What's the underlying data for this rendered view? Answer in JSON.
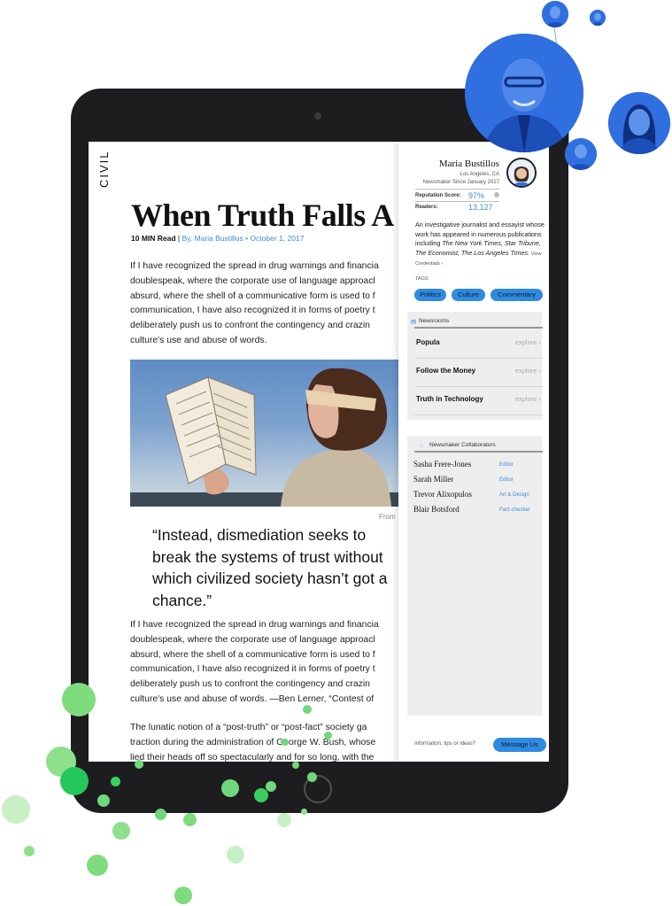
{
  "article": {
    "publication_logo": "CIVIL",
    "headline": "When Truth Falls A",
    "byline_read_time": "10 MIN Read",
    "byline_separator": " | ",
    "byline_author": "By, Maria Bustillos",
    "byline_date": " • October 1, 2017",
    "paragraph_1": "If I have recognized the spread in drug warnings and financia\ndoublespeak, where the corporate use of language approacl\nabsurd, where the shell of a communicative form is used to f\ncommunication, I have also recognized it in forms of poetry t\ndeliberately push us to confront the contingency and crazin\nculture's use and abuse of words.",
    "image_caption": "From",
    "pull_quote": "“Instead, dismediation seeks to break the systems of trust without which civilized society hasn’t got a chance.”",
    "paragraph_2": "If I have recognized the spread in drug warnings and financia\ndoublespeak, where the corporate use of language approacl\nabsurd, where the shell of a communicative form is used to f\ncommunication, I have also recognized it in forms of poetry t\ndeliberately push us to confront the contingency and crazin\nculture's use and abuse of words. —Ben Lerner, “Contest of",
    "paragraph_3": "The lunatic notion of a “post-truth” or “post-fact” society ga\ntraction during the administration of George W. Bush, whose\nlied their heads off so spectacularly and for so long, with the"
  },
  "author": {
    "name": "Maria Bustillos",
    "location": "Los Angeles, CA",
    "since": "Newsmaker Since January 2017",
    "reputation_label": "Reputation Score:",
    "reputation_value": "97%",
    "readers_label": "Readers:",
    "readers_value": "13,127",
    "bio_text": "An investigative journalist and essayist whose work has appeared in numerous publications including ",
    "bio_pubs": "The New York Times, Star Tribune, The Economist, The Los Angeles Times.",
    "bio_credentials": " View Credentials ›"
  },
  "tags": {
    "label": "TAGS",
    "items": [
      "Politics",
      "Culture",
      "Commentary"
    ]
  },
  "newsrooms": {
    "title": "Newsrooms",
    "items": [
      {
        "name": "Popula",
        "link": "explore ›"
      },
      {
        "name": "Follow the Money",
        "link": "explore ›"
      },
      {
        "name": "Truth in Technology",
        "link": "explore ›"
      }
    ]
  },
  "collaborators": {
    "title": "Newsmaker Collaborators",
    "items": [
      {
        "name": "Sasha Frere-Jones",
        "role": "Editor"
      },
      {
        "name": "Sarah Miller",
        "role": "Editor"
      },
      {
        "name": "Trevor Alixopulos",
        "role": "Art & Design"
      },
      {
        "name": "Blair Botsford",
        "role": "Fact-checker"
      }
    ]
  },
  "footer": {
    "prompt": "Information, tips or ideas?",
    "message_button": "Message Us"
  },
  "colors": {
    "accent_blue": "#2f8be0",
    "link_blue": "#3a8dde",
    "avatar_blue": "#2f6fe0",
    "dot_green": "#5fd86b",
    "device_black": "#1d1d1f"
  },
  "icons": [
    "newsroom-icon",
    "collaborators-icon",
    "info-icon",
    "home-button"
  ]
}
